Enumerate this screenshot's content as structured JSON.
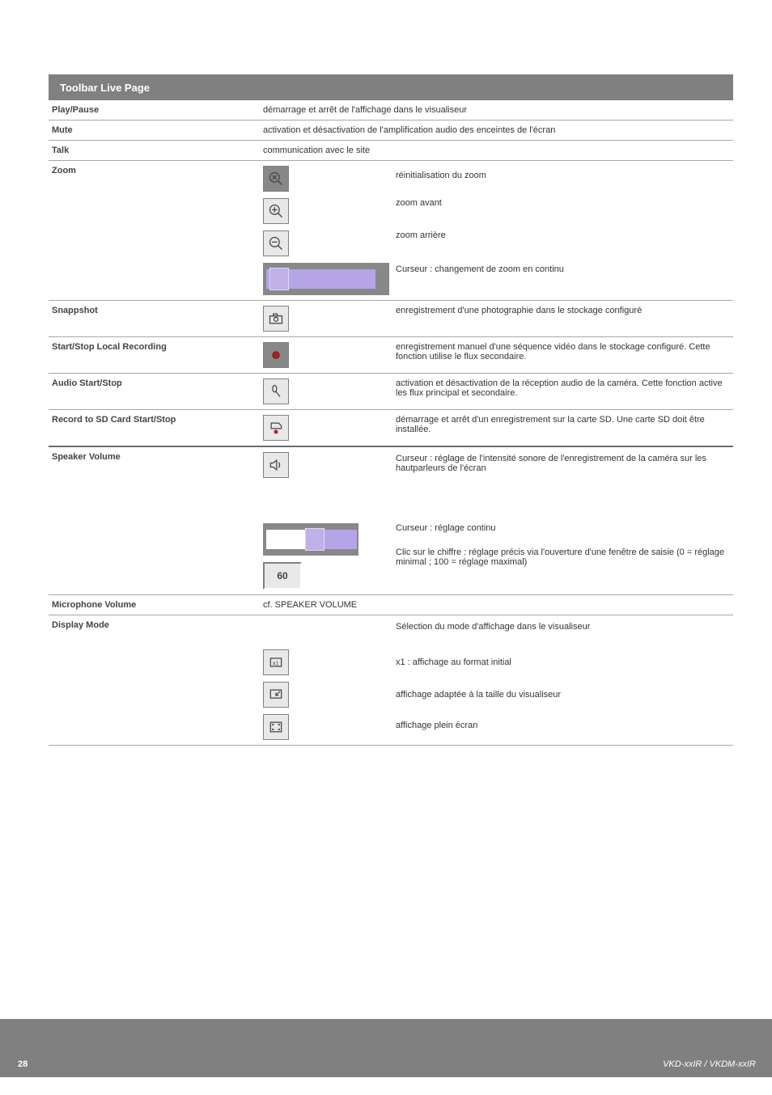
{
  "title_bar": "Toolbar Live Page",
  "rows": [
    {
      "label": "Play/Pause",
      "desc": "démarrage et arrêt de l'affichage dans le visualiseur"
    },
    {
      "label": "Mute",
      "desc": "activation et désactivation de l'amplification audio des enceintes de l'écran"
    },
    {
      "label": "Talk",
      "desc": "communication avec le site"
    },
    {
      "label": "Zoom",
      "items": [
        {
          "desc": "réinitialisation du zoom"
        },
        {
          "desc": "zoom avant"
        },
        {
          "desc": "zoom arrière"
        },
        {
          "desc": "Curseur : changement de zoom en continu"
        }
      ]
    },
    {
      "label": "Snappshot",
      "desc": "enregistrement d'une photographie dans le stockage configuré"
    },
    {
      "label": "Start/Stop Local Recording",
      "desc": "enregistrement manuel d'une séquence vidéo dans le stockage configuré. Cette fonction utilise le flux secondaire."
    },
    {
      "label": "Audio Start/Stop",
      "desc": "activation et désactivation de la réception audio de la caméra. Cette fonction active les flux principal et secondaire."
    },
    {
      "label": "Record to SD Card Start/Stop",
      "desc": "démarrage et arrêt d'un enregistrement sur la carte SD. Une carte SD doit être installée."
    },
    {
      "label": "Speaker Volume",
      "items": [
        {
          "desc": "Curseur : réglage de l'intensité sonore de l'enregistrement de la caméra sur les hautparleurs de l'écran"
        },
        {
          "desc": "Curseur : réglage continu"
        },
        {
          "desc": "Clic sur le chiffre : réglage précis via l'ouverture d'une fenêtre de saisie (0 = réglage minimal ; 100 = réglage maximal)"
        }
      ],
      "num": "60"
    },
    {
      "label": "Microphone Volume",
      "desc": "cf. SPEAKER VOLUME"
    },
    {
      "label": "Display Mode",
      "items": [
        {
          "desc": "Sélection du mode d'affichage dans le visualiseur"
        },
        {
          "desc": "x1 : affichage au format initial"
        },
        {
          "desc": "affichage adaptée à la taille du visualiseur"
        },
        {
          "desc": "affichage plein écran"
        }
      ]
    }
  ],
  "footer": {
    "left": "",
    "pg": "28",
    "right": "VKD-xxIR / VKDM-xxIR"
  }
}
